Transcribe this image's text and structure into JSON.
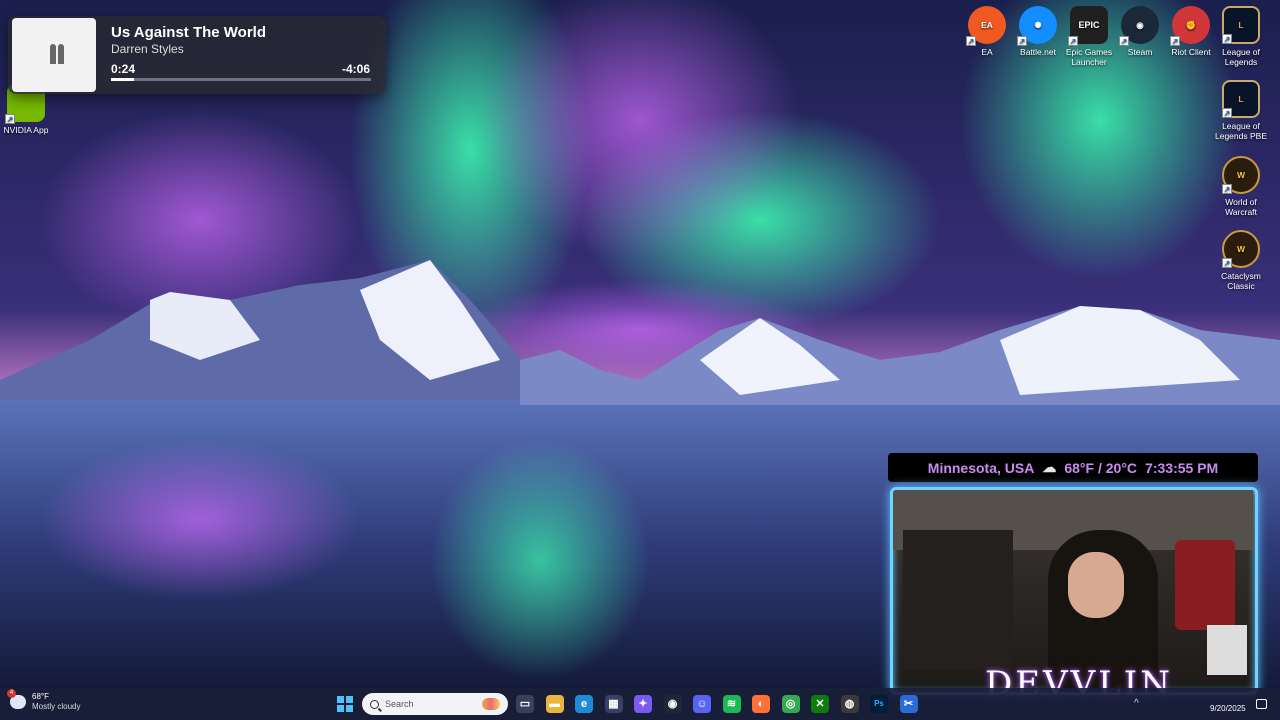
{
  "media": {
    "title": "Us Against The World",
    "artist": "Darren Styles",
    "elapsed": "0:24",
    "remaining": "-4:06",
    "progress_fraction": 0.09
  },
  "desktop_left": [
    {
      "label": "NVIDIA App",
      "icon": "nvidia-icon",
      "color": "#76b900"
    }
  ],
  "desktop_right": [
    {
      "label": "EA",
      "icon": "ea-icon",
      "color": "#f05a22"
    },
    {
      "label": "Battle.net",
      "icon": "battlenet-icon",
      "color": "#148eff"
    },
    {
      "label": "Epic Games Launcher",
      "icon": "epic-games-icon",
      "color": "#202020"
    },
    {
      "label": "Steam",
      "icon": "steam-icon",
      "color": "#1b2838"
    },
    {
      "label": "Riot Client",
      "icon": "riot-client-icon",
      "color": "#d13639"
    },
    {
      "label": "League of Legends",
      "icon": "league-of-legends-icon",
      "color": "#c8aa6e"
    },
    {
      "label": "League of Legends PBE",
      "icon": "league-of-legends-pbe-icon",
      "color": "#c8aa6e"
    },
    {
      "label": "World of Warcraft",
      "icon": "world-of-warcraft-icon",
      "color": "#c89b3c"
    },
    {
      "label": "Cataclysm Classic",
      "icon": "cataclysm-classic-icon",
      "color": "#c89b3c"
    }
  ],
  "stream": {
    "location": "Minnesota, USA",
    "weather_icon": "partly-cloudy-icon",
    "temperature": "68°F / 20°C",
    "time": "7:33:55 PM",
    "brand": "DEVVLIN"
  },
  "taskbar": {
    "weather_temp": "68°F",
    "weather_condition": "Mostly cloudy",
    "weather_badge": "4",
    "search_placeholder": "Search",
    "date": "9/20/2025",
    "tray_chevron": "^",
    "apps": [
      {
        "name": "task-view-icon",
        "glyph": "▭",
        "color": "#3b3f5c"
      },
      {
        "name": "file-explorer-icon",
        "glyph": "▬",
        "color": "#e9b53c"
      },
      {
        "name": "edge-icon",
        "glyph": "e",
        "color": "#1f8ad6"
      },
      {
        "name": "store-icon",
        "glyph": "▦",
        "color": "#3a3f66"
      },
      {
        "name": "copilot-icon",
        "glyph": "✦",
        "color": "#7a5af0"
      },
      {
        "name": "steam-taskbar-icon",
        "glyph": "◉",
        "color": "#1b2838"
      },
      {
        "name": "discord-icon",
        "glyph": "☺",
        "color": "#5865f2"
      },
      {
        "name": "spotify-icon",
        "glyph": "≋",
        "color": "#1db954"
      },
      {
        "name": "firefox-icon",
        "glyph": "◐",
        "color": "#ff7139"
      },
      {
        "name": "chrome-icon",
        "glyph": "◎",
        "color": "#34a853"
      },
      {
        "name": "xbox-icon",
        "glyph": "✕",
        "color": "#107c10"
      },
      {
        "name": "obs-icon",
        "glyph": "◍",
        "color": "#3a3a3a"
      },
      {
        "name": "photoshop-icon",
        "glyph": "Ps",
        "color": "#001e36"
      },
      {
        "name": "snipping-tool-icon",
        "glyph": "✂",
        "color": "#2a6bd8"
      }
    ]
  }
}
